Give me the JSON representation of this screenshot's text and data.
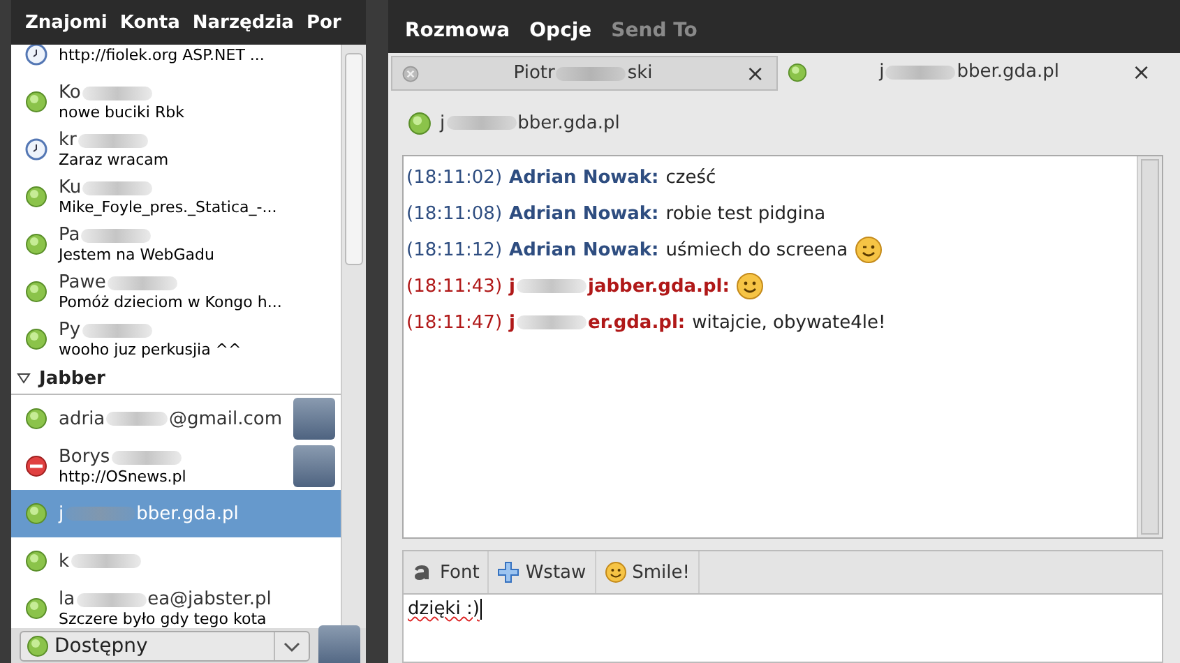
{
  "buddy_list": {
    "menu": [
      {
        "label": "Znajomi"
      },
      {
        "label": "Konta"
      },
      {
        "label": "Narzędzia"
      },
      {
        "label": "Por"
      }
    ],
    "contacts": [
      {
        "status_text": "http://fiolek.org  ASP.NET ...",
        "kind": "away",
        "avatar": false,
        "selected": false
      },
      {
        "name": [
          "Ko"
        ],
        "status_text": "nowe buciki Rbk",
        "kind": "available",
        "avatar": false,
        "selected": false
      },
      {
        "name": [
          "kr"
        ],
        "status_text": "Zaraz wracam",
        "kind": "away",
        "avatar": false,
        "selected": false
      },
      {
        "name": [
          "Ku"
        ],
        "status_text": "Mike_Foyle_pres._Statica_-...",
        "kind": "available",
        "avatar": false,
        "selected": false
      },
      {
        "name": [
          "Pa"
        ],
        "status_text": "Jestem na WebGadu",
        "kind": "available",
        "avatar": false,
        "selected": false
      },
      {
        "name": [
          "Pawe"
        ],
        "status_text": "Pomóż dzieciom w Kongo h...",
        "kind": "available",
        "avatar": false,
        "selected": false
      },
      {
        "name": [
          "Py"
        ],
        "status_text": "wooho juz perkusjia ^^",
        "kind": "available",
        "avatar": false,
        "selected": false
      }
    ],
    "groups": [
      {
        "label": "Jabber",
        "expanded": true,
        "contacts": [
          {
            "name": [
              "adria",
              "@gmail.com"
            ],
            "kind": "available",
            "avatar": true,
            "selected": false
          },
          {
            "name": [
              "Borys"
            ],
            "status_text": "http://OSnews.pl",
            "kind": "busy",
            "avatar": true,
            "selected": false
          },
          {
            "name": [
              "j",
              "bber.gda.pl"
            ],
            "kind": "available",
            "avatar": false,
            "selected": true
          },
          {
            "name": [
              "k"
            ],
            "kind": "available",
            "avatar": false,
            "selected": false
          },
          {
            "name": [
              "la",
              "ea@jabster.pl"
            ],
            "status_text": "Szczere było gdy tego kota",
            "kind": "available",
            "avatar": false,
            "selected": false
          }
        ]
      }
    ],
    "status_selector": {
      "value": "Dostępny",
      "kind": "available"
    }
  },
  "chat_window": {
    "menu": [
      {
        "label": "Rozmowa",
        "disabled": false
      },
      {
        "label": "Opcje",
        "disabled": false
      },
      {
        "label": "Send To",
        "disabled": true
      }
    ],
    "tabs": [
      {
        "label": [
          "Piotr",
          "ski"
        ],
        "kind": "offline",
        "selected": false,
        "close": "×"
      },
      {
        "label": [
          "j",
          "bber.gda.pl"
        ],
        "kind": "available",
        "selected": true,
        "close": "×"
      }
    ],
    "header": {
      "name": [
        "j",
        "bber.gda.pl"
      ],
      "kind": "available"
    },
    "messages": [
      {
        "time": "(18:11:02)",
        "sender": [
          "Adrian Nowak:"
        ],
        "kind": "incoming",
        "text": "cześć"
      },
      {
        "time": "(18:11:08)",
        "sender": [
          "Adrian Nowak:"
        ],
        "kind": "incoming",
        "text": "robie test pidgina"
      },
      {
        "time": "(18:11:12)",
        "sender": [
          "Adrian Nowak:"
        ],
        "kind": "incoming",
        "text": "uśmiech do screena",
        "emoticon": {
          "kind": "wink"
        }
      },
      {
        "time": "(18:11:43)",
        "sender": [
          "j",
          "jabber.gda.pl:"
        ],
        "kind": "outgoing",
        "emoticon": {
          "kind": "smile"
        }
      },
      {
        "time": "(18:11:47)",
        "sender": [
          "j",
          "er.gda.pl:"
        ],
        "kind": "outgoing",
        "text": "witajcie, obywate4le!"
      }
    ],
    "toolbar": [
      {
        "label": "Font",
        "kind": "font"
      },
      {
        "label": "Wstaw",
        "kind": "insert"
      },
      {
        "label": "Smile!",
        "kind": "smile"
      }
    ],
    "input": {
      "value": "dzięki :)"
    }
  }
}
